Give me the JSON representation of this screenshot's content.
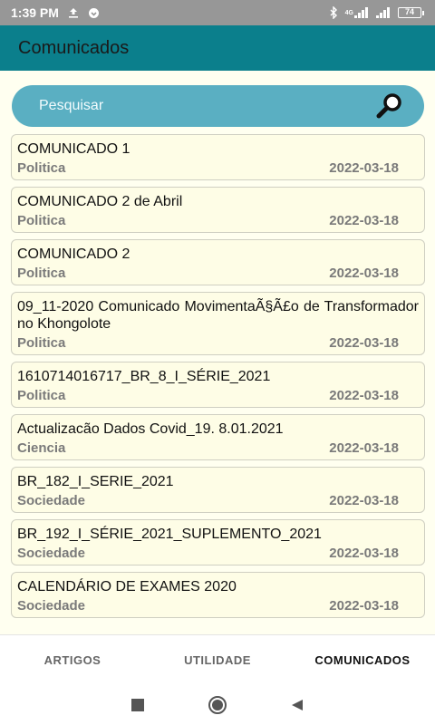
{
  "status": {
    "time": "1:39 PM",
    "battery": "74",
    "network": "4G"
  },
  "app_bar": {
    "title": "Comunicados"
  },
  "search": {
    "placeholder": "Pesquisar"
  },
  "items": [
    {
      "title": "COMUNICADO 1",
      "category": "Politica",
      "date": "2022-03-18"
    },
    {
      "title": "COMUNICADO 2 de Abril",
      "category": "Politica",
      "date": "2022-03-18"
    },
    {
      "title": "COMUNICADO 2",
      "category": "Politica",
      "date": "2022-03-18"
    },
    {
      "title": "09_11-2020 Comunicado MovimentaÃ§Ã£o de Transformador no Khongolote",
      "category": "Politica",
      "date": "2022-03-18"
    },
    {
      "title": "1610714016717_BR_8_I_SÉRIE_2021",
      "category": "Politica",
      "date": "2022-03-18"
    },
    {
      "title": "Actualizacão Dados Covid_19. 8.01.2021",
      "category": "Ciencia",
      "date": "2022-03-18"
    },
    {
      "title": "BR_182_I_SERIE_2021",
      "category": "Sociedade",
      "date": "2022-03-18"
    },
    {
      "title": "BR_192_I_SÉRIE_2021_SUPLEMENTO_2021",
      "category": "Sociedade",
      "date": "2022-03-18"
    },
    {
      "title": "CALENDÁRIO DE EXAMES 2020",
      "category": "Sociedade",
      "date": "2022-03-18"
    }
  ],
  "bottom_nav": {
    "items": [
      "ARTIGOS",
      "UTILIDADE",
      "COMUNICADOS"
    ],
    "active": "COMUNICADOS"
  },
  "colors": {
    "app_bar": "#0b7f8c",
    "search": "#5aafc2",
    "status_bar": "#979797",
    "card_bg": "#fefde6"
  }
}
